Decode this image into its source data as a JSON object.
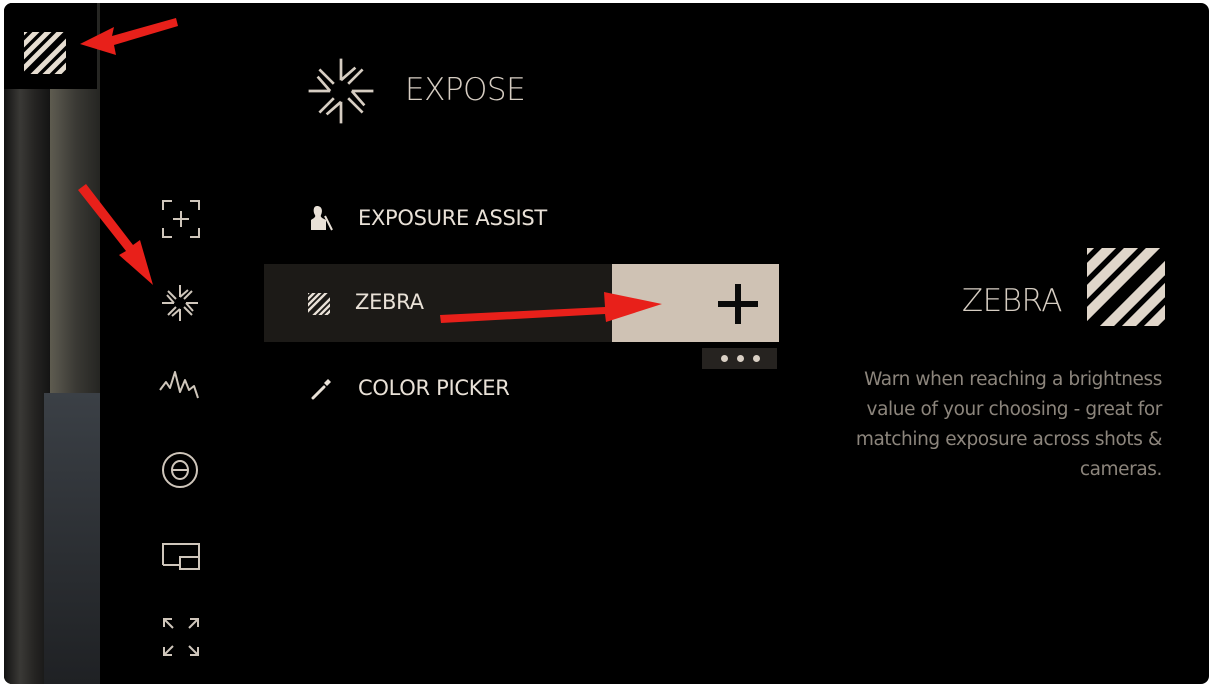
{
  "header": {
    "title": "EXPOSE",
    "icon": "aperture-icon"
  },
  "sidebar": {
    "items": [
      {
        "name": "focus-assist",
        "icon": "focus-frame-icon"
      },
      {
        "name": "expose",
        "icon": "aperture-icon",
        "selected": true
      },
      {
        "name": "waveform",
        "icon": "waveform-icon"
      },
      {
        "name": "exposure-compensation",
        "icon": "circle-minus-icon"
      },
      {
        "name": "picture-in-picture",
        "icon": "pip-icon"
      },
      {
        "name": "fullscreen",
        "icon": "expand-icon"
      }
    ]
  },
  "menu": {
    "items": [
      {
        "label": "EXPOSURE ASSIST",
        "icon": "person-silhouette-icon"
      },
      {
        "label": "ZEBRA",
        "icon": "zebra-stripes-icon",
        "highlighted": true
      },
      {
        "label": "COLOR PICKER",
        "icon": "eyedropper-icon"
      }
    ]
  },
  "add_button": {
    "icon": "plus-icon"
  },
  "more_button": {
    "icon": "more-dots-icon"
  },
  "detail": {
    "title": "ZEBRA",
    "icon": "zebra-stripes-icon",
    "description": "Warn when reaching a brightness value of your choosing - great for matching exposure across shots & cameras."
  },
  "colors": {
    "background": "#000000",
    "accent": "#cfc2b4",
    "text": "#e9e1d7",
    "annotation_arrow": "#e8201a"
  }
}
